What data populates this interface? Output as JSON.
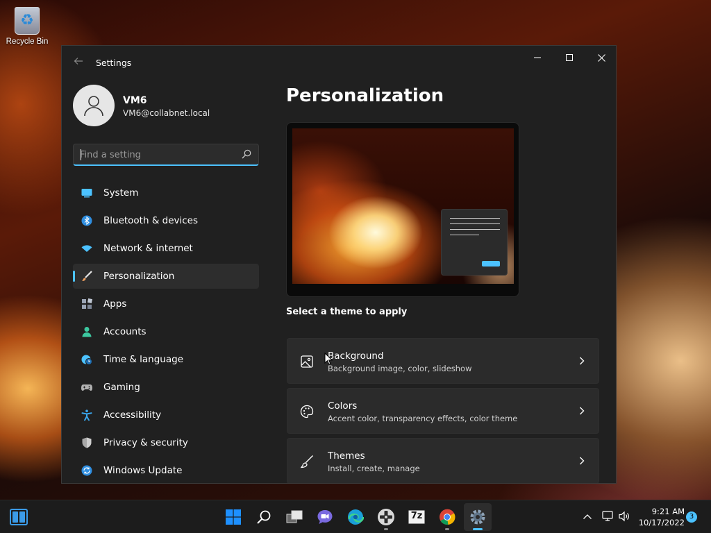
{
  "desktop": {
    "icons": [
      {
        "label": "Recycle Bin",
        "icon": "recycle-bin-icon"
      }
    ]
  },
  "window": {
    "title": "Settings",
    "controls": {
      "minimize": "—"
    }
  },
  "profile": {
    "name": "VM6",
    "email": "VM6@collabnet.local"
  },
  "search": {
    "placeholder": "Find a setting",
    "value": ""
  },
  "nav": {
    "items": [
      {
        "label": "System",
        "icon": "system-icon",
        "color": "#4cc2ff"
      },
      {
        "label": "Bluetooth & devices",
        "icon": "bluetooth-icon",
        "color": "#2f8ee0"
      },
      {
        "label": "Network & internet",
        "icon": "wifi-icon",
        "color": "#4cc2ff"
      },
      {
        "label": "Personalization",
        "icon": "brush-icon",
        "color": "#f0a060",
        "active": true
      },
      {
        "label": "Apps",
        "icon": "apps-icon",
        "color": "#9aa4b4"
      },
      {
        "label": "Accounts",
        "icon": "accounts-icon",
        "color": "#3cc8a0"
      },
      {
        "label": "Time & language",
        "icon": "globe-clock-icon",
        "color": "#4cc2ff"
      },
      {
        "label": "Gaming",
        "icon": "gamepad-icon",
        "color": "#b0b0b0"
      },
      {
        "label": "Accessibility",
        "icon": "accessibility-icon",
        "color": "#3aa8f0"
      },
      {
        "label": "Privacy & security",
        "icon": "shield-icon",
        "color": "#a8a8a8"
      },
      {
        "label": "Windows Update",
        "icon": "update-icon",
        "color": "#2f8ee0"
      }
    ]
  },
  "main": {
    "title": "Personalization",
    "theme_section_label": "Select a theme to apply",
    "cards": [
      {
        "title": "Background",
        "subtitle": "Background image, color, slideshow",
        "icon": "image-icon"
      },
      {
        "title": "Colors",
        "subtitle": "Accent color, transparency effects, color theme",
        "icon": "palette-icon"
      },
      {
        "title": "Themes",
        "subtitle": "Install, create, manage",
        "icon": "brush-icon"
      }
    ]
  },
  "taskbar": {
    "apps": [
      {
        "name": "start",
        "icon": "windows-start-icon"
      },
      {
        "name": "search",
        "icon": "search-icon"
      },
      {
        "name": "task-view",
        "icon": "task-view-icon"
      },
      {
        "name": "chat",
        "icon": "chat-icon"
      },
      {
        "name": "edge",
        "icon": "edge-icon"
      },
      {
        "name": "remote",
        "icon": "remote-desktop-icon"
      },
      {
        "name": "7zip",
        "icon": "seven-zip-icon",
        "label": "7z"
      },
      {
        "name": "chrome",
        "icon": "chrome-icon"
      },
      {
        "name": "settings",
        "icon": "settings-gear-icon"
      }
    ],
    "time": "9:21 AM",
    "date": "10/17/2022",
    "notification_count": "3"
  },
  "colors": {
    "accent": "#4cc2ff",
    "window_bg": "#202020",
    "card_bg": "#2b2b2b"
  }
}
